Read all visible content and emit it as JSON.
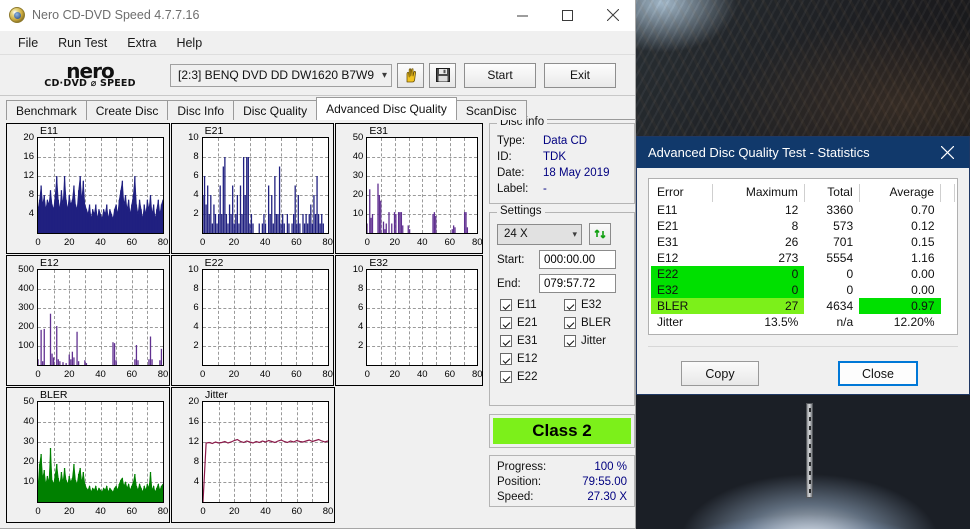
{
  "window": {
    "title": "Nero CD-DVD Speed 4.7.7.16",
    "icon": "nero-disc-icon",
    "minimize": "minimize-icon",
    "maximize": "maximize-icon",
    "close": "close-icon"
  },
  "menubar": {
    "items": [
      "File",
      "Run Test",
      "Extra",
      "Help"
    ]
  },
  "toolbar": {
    "logo_line1": "nero",
    "logo_line2": "CD·DVD ⌀ SPEED",
    "drive": "[2:3]   BENQ DVD DD DW1620 B7W9",
    "eject_icon": "eject-hand-icon",
    "save_icon": "floppy-save-icon",
    "start_label": "Start",
    "exit_label": "Exit"
  },
  "tabs": [
    {
      "label": "Benchmark",
      "active": false
    },
    {
      "label": "Create Disc",
      "active": false
    },
    {
      "label": "Disc Info",
      "active": false
    },
    {
      "label": "Disc Quality",
      "active": false
    },
    {
      "label": "Advanced Disc Quality",
      "active": true
    },
    {
      "label": "ScanDisc",
      "active": false
    }
  ],
  "disc_info": {
    "legend": "Disc info",
    "rows": [
      {
        "key": "Type:",
        "value": "Data CD"
      },
      {
        "key": "ID:",
        "value": "TDK"
      },
      {
        "key": "Date:",
        "value": "18 May 2019"
      },
      {
        "key": "Label:",
        "value": "-"
      }
    ]
  },
  "settings": {
    "legend": "Settings",
    "speed": "24 X",
    "refresh_icon": "refresh-icon",
    "start_label": "Start:",
    "start_value": "000:00.00",
    "end_label": "End:",
    "end_value": "079:57.72",
    "checkboxes": [
      {
        "label": "E11",
        "checked": true
      },
      {
        "label": "E32",
        "checked": true
      },
      {
        "label": "E21",
        "checked": true
      },
      {
        "label": "BLER",
        "checked": true
      },
      {
        "label": "E31",
        "checked": true
      },
      {
        "label": "Jitter",
        "checked": true
      },
      {
        "label": "E12",
        "checked": true
      },
      {
        "label": "",
        "checked": false
      },
      {
        "label": "E22",
        "checked": true
      },
      {
        "label": "",
        "checked": false
      }
    ]
  },
  "class_badge": {
    "label": "Class 2",
    "color": "#7cf01a"
  },
  "progress_panel": {
    "rows": [
      {
        "key": "Progress:",
        "value": "100 %"
      },
      {
        "key": "Position:",
        "value": "79:55.00"
      },
      {
        "key": "Speed:",
        "value": "27.30 X"
      }
    ]
  },
  "dialog": {
    "title": "Advanced Disc Quality Test - Statistics",
    "close_icon": "close-icon",
    "columns": [
      "Error",
      "Maximum",
      "Total",
      "Average"
    ],
    "rows": [
      {
        "error": "E11",
        "maximum": "12",
        "total": "3360",
        "average": "0.70",
        "highlight": "none"
      },
      {
        "error": "E21",
        "maximum": "8",
        "total": "573",
        "average": "0.12",
        "highlight": "none"
      },
      {
        "error": "E31",
        "maximum": "26",
        "total": "701",
        "average": "0.15",
        "highlight": "none"
      },
      {
        "error": "E12",
        "maximum": "273",
        "total": "5554",
        "average": "1.16",
        "highlight": "none"
      },
      {
        "error": "E22",
        "maximum": "0",
        "total": "0",
        "average": "0.00",
        "highlight": "green-left"
      },
      {
        "error": "E32",
        "maximum": "0",
        "total": "0",
        "average": "0.00",
        "highlight": "green-left"
      },
      {
        "error": "BLER",
        "maximum": "27",
        "total": "4634",
        "average": "0.97",
        "highlight": "lime-left-green-avg"
      },
      {
        "error": "Jitter",
        "maximum": "13.5%",
        "total": "n/a",
        "average": "12.20%",
        "highlight": "none"
      }
    ],
    "copy_label": "Copy",
    "close_label": "Close",
    "colors": {
      "green": "#00e000",
      "lime": "#7cf01a",
      "titlebar": "#11396b",
      "focus": "#0078d7"
    }
  },
  "chart_data": [
    {
      "type": "area",
      "title": "E11",
      "xlabel": "",
      "ylabel": "",
      "xlim": [
        0,
        80
      ],
      "ylim": [
        0,
        20
      ],
      "grid": true,
      "xticks": [
        0,
        20,
        40,
        60,
        80
      ],
      "yticks": [
        4,
        8,
        12,
        16,
        20
      ],
      "color": "#202080",
      "x": [
        0,
        1,
        2,
        3,
        4,
        5,
        6,
        7,
        8,
        9,
        10,
        11,
        12,
        13,
        14,
        15,
        16,
        17,
        18,
        19,
        20,
        21,
        22,
        23,
        24,
        25,
        26,
        27,
        28,
        29,
        30,
        31,
        32,
        33,
        34,
        35,
        36,
        37,
        38,
        39,
        40,
        41,
        42,
        43,
        44,
        45,
        46,
        47,
        48,
        49,
        50,
        51,
        52,
        53,
        54,
        55,
        56,
        57,
        58,
        59,
        60,
        61,
        62,
        63,
        64,
        65,
        66,
        67,
        68,
        69,
        70,
        71,
        72,
        73,
        74,
        75,
        76,
        77,
        78,
        79,
        80
      ],
      "values": [
        5,
        7,
        10,
        6,
        8,
        5,
        7,
        6,
        9,
        6,
        5,
        8,
        12,
        7,
        5,
        9,
        6,
        12,
        7,
        5,
        8,
        6,
        7,
        10,
        6,
        5,
        9,
        12,
        7,
        11,
        6,
        5,
        4,
        6,
        3,
        5,
        4,
        6,
        3,
        5,
        4,
        3,
        5,
        4,
        6,
        3,
        5,
        4,
        3,
        5,
        6,
        4,
        7,
        9,
        11,
        6,
        8,
        5,
        7,
        4,
        6,
        8,
        12,
        6,
        4,
        7,
        5,
        3,
        6,
        4,
        7,
        5,
        8,
        4,
        6,
        3,
        5,
        7,
        4,
        6,
        7
      ]
    },
    {
      "type": "bar",
      "title": "E21",
      "xlabel": "",
      "ylabel": "",
      "xlim": [
        0,
        80
      ],
      "ylim": [
        0,
        10
      ],
      "grid": true,
      "xticks": [
        0,
        20,
        40,
        60,
        80
      ],
      "yticks": [
        2,
        4,
        6,
        8,
        10
      ],
      "color": "#202080",
      "x": [
        0,
        1,
        2,
        3,
        4,
        5,
        6,
        7,
        8,
        9,
        10,
        11,
        12,
        13,
        14,
        15,
        16,
        17,
        18,
        19,
        20,
        21,
        22,
        23,
        24,
        25,
        26,
        27,
        28,
        29,
        30,
        31,
        32,
        33,
        34,
        35,
        36,
        37,
        38,
        39,
        40,
        41,
        42,
        43,
        44,
        45,
        46,
        47,
        48,
        49,
        50,
        51,
        52,
        53,
        54,
        55,
        56,
        57,
        58,
        59,
        60,
        61,
        62,
        63,
        64,
        65,
        66,
        67,
        68,
        69,
        70,
        71,
        72,
        73,
        74,
        75,
        76,
        77,
        78,
        79,
        80
      ],
      "values": [
        4,
        6,
        3,
        5,
        2,
        4,
        1,
        3,
        2,
        1,
        2,
        5,
        2,
        7,
        8,
        2,
        1,
        3,
        2,
        5,
        1,
        2,
        4,
        1,
        5,
        2,
        8,
        4,
        8,
        8,
        1,
        2,
        1,
        0,
        0,
        0,
        1,
        0,
        1,
        2,
        1,
        0,
        5,
        2,
        4,
        1,
        6,
        2,
        2,
        7,
        1,
        2,
        1,
        0,
        2,
        1,
        0,
        1,
        2,
        5,
        1,
        4,
        1,
        0,
        2,
        1,
        2,
        1,
        2,
        3,
        1,
        4,
        2,
        6,
        2,
        1,
        2,
        1,
        0,
        0,
        0
      ]
    },
    {
      "type": "bar",
      "title": "E31",
      "xlabel": "",
      "ylabel": "",
      "xlim": [
        0,
        80
      ],
      "ylim": [
        0,
        50
      ],
      "grid": true,
      "xticks": [
        0,
        20,
        40,
        60,
        80
      ],
      "yticks": [
        10,
        20,
        30,
        40,
        50
      ],
      "color": "#603090",
      "x": [
        0,
        2,
        3,
        4,
        8,
        9,
        10,
        12,
        13,
        14,
        16,
        18,
        20,
        21,
        23,
        24,
        25,
        26,
        30,
        31,
        48,
        49,
        50,
        62,
        63,
        64,
        71,
        72,
        73
      ],
      "values": [
        5,
        23,
        8,
        10,
        26,
        20,
        17,
        6,
        2,
        5,
        11,
        5,
        11,
        10,
        11,
        11,
        11,
        4,
        4,
        2,
        10,
        11,
        9,
        2,
        4,
        3,
        11,
        11,
        3
      ]
    },
    {
      "type": "bar",
      "title": "E12",
      "xlabel": "",
      "ylabel": "",
      "xlim": [
        0,
        80
      ],
      "ylim": [
        0,
        500
      ],
      "grid": true,
      "xticks": [
        0,
        20,
        40,
        60,
        80
      ],
      "yticks": [
        100,
        200,
        300,
        400,
        500
      ],
      "color": "#603090",
      "x": [
        0,
        2,
        3,
        4,
        8,
        9,
        10,
        12,
        13,
        14,
        16,
        18,
        20,
        21,
        22,
        23,
        25,
        26,
        30,
        31,
        48,
        49,
        50,
        62,
        63,
        64,
        71,
        72,
        73,
        78,
        79
      ],
      "values": [
        30,
        185,
        20,
        190,
        270,
        60,
        40,
        205,
        30,
        20,
        15,
        10,
        55,
        30,
        70,
        40,
        175,
        20,
        25,
        10,
        120,
        115,
        25,
        30,
        105,
        25,
        30,
        150,
        30,
        25,
        85
      ]
    },
    {
      "type": "bar",
      "title": "E22",
      "xlabel": "",
      "ylabel": "",
      "xlim": [
        0,
        80
      ],
      "ylim": [
        0,
        10
      ],
      "grid": true,
      "xticks": [
        0,
        20,
        40,
        60,
        80
      ],
      "yticks": [
        2,
        4,
        6,
        8,
        10
      ],
      "color": "#202080",
      "x": [],
      "values": []
    },
    {
      "type": "bar",
      "title": "E32",
      "xlabel": "",
      "ylabel": "",
      "xlim": [
        0,
        80
      ],
      "ylim": [
        0,
        10
      ],
      "grid": true,
      "xticks": [
        0,
        20,
        40,
        60,
        80
      ],
      "yticks": [
        2,
        4,
        6,
        8,
        10
      ],
      "color": "#202080",
      "x": [],
      "values": []
    },
    {
      "type": "area",
      "title": "BLER",
      "xlabel": "",
      "ylabel": "",
      "xlim": [
        0,
        80
      ],
      "ylim": [
        0,
        50
      ],
      "grid": true,
      "xticks": [
        0,
        20,
        40,
        60,
        80
      ],
      "yticks": [
        10,
        20,
        30,
        40,
        50
      ],
      "color": "#008000",
      "x": [
        0,
        1,
        2,
        3,
        4,
        5,
        6,
        7,
        8,
        9,
        10,
        11,
        12,
        13,
        14,
        15,
        16,
        17,
        18,
        19,
        20,
        21,
        22,
        23,
        24,
        25,
        26,
        27,
        28,
        29,
        30,
        31,
        32,
        33,
        34,
        35,
        36,
        37,
        38,
        39,
        40,
        41,
        42,
        43,
        44,
        45,
        46,
        47,
        48,
        49,
        50,
        51,
        52,
        53,
        54,
        55,
        56,
        57,
        58,
        59,
        60,
        61,
        62,
        63,
        64,
        65,
        66,
        67,
        68,
        69,
        70,
        71,
        72,
        73,
        74,
        75,
        76,
        77,
        78,
        79,
        80
      ],
      "values": [
        8,
        19,
        24,
        12,
        16,
        9,
        13,
        10,
        27,
        11,
        9,
        14,
        19,
        12,
        9,
        15,
        10,
        17,
        11,
        9,
        13,
        10,
        12,
        19,
        11,
        9,
        14,
        17,
        10,
        15,
        9,
        7,
        6,
        8,
        5,
        7,
        6,
        8,
        5,
        7,
        6,
        5,
        7,
        6,
        8,
        5,
        7,
        6,
        5,
        7,
        8,
        6,
        9,
        11,
        12,
        8,
        10,
        7,
        9,
        6,
        8,
        10,
        14,
        8,
        6,
        9,
        7,
        5,
        8,
        6,
        9,
        7,
        15,
        6,
        8,
        5,
        7,
        9,
        6,
        8,
        9
      ]
    },
    {
      "type": "line",
      "title": "Jitter",
      "xlabel": "",
      "ylabel": "",
      "xlim": [
        0,
        80
      ],
      "ylim": [
        0,
        20
      ],
      "grid": true,
      "xticks": [
        0,
        20,
        40,
        60,
        80
      ],
      "yticks": [
        4,
        8,
        12,
        16,
        20
      ],
      "color": "#8b1a4a",
      "x": [
        0,
        2,
        4,
        6,
        8,
        10,
        12,
        14,
        16,
        18,
        20,
        22,
        24,
        26,
        28,
        30,
        32,
        34,
        36,
        38,
        40,
        42,
        44,
        46,
        48,
        50,
        52,
        54,
        56,
        58,
        60,
        62,
        64,
        66,
        68,
        70,
        72,
        74,
        76,
        78,
        80
      ],
      "values": [
        0,
        11.8,
        11.9,
        11.7,
        12.0,
        11.8,
        11.9,
        12.1,
        11.8,
        12.0,
        12.3,
        12.5,
        12.1,
        11.9,
        12.2,
        12.0,
        11.8,
        12.1,
        11.9,
        12.2,
        12.0,
        12.3,
        12.1,
        11.9,
        12.2,
        12.4,
        12.1,
        11.9,
        12.2,
        12.0,
        12.3,
        12.1,
        12.0,
        12.2,
        12.4,
        12.1,
        12.3,
        12.5,
        12.2,
        12.0,
        12.2
      ]
    }
  ]
}
